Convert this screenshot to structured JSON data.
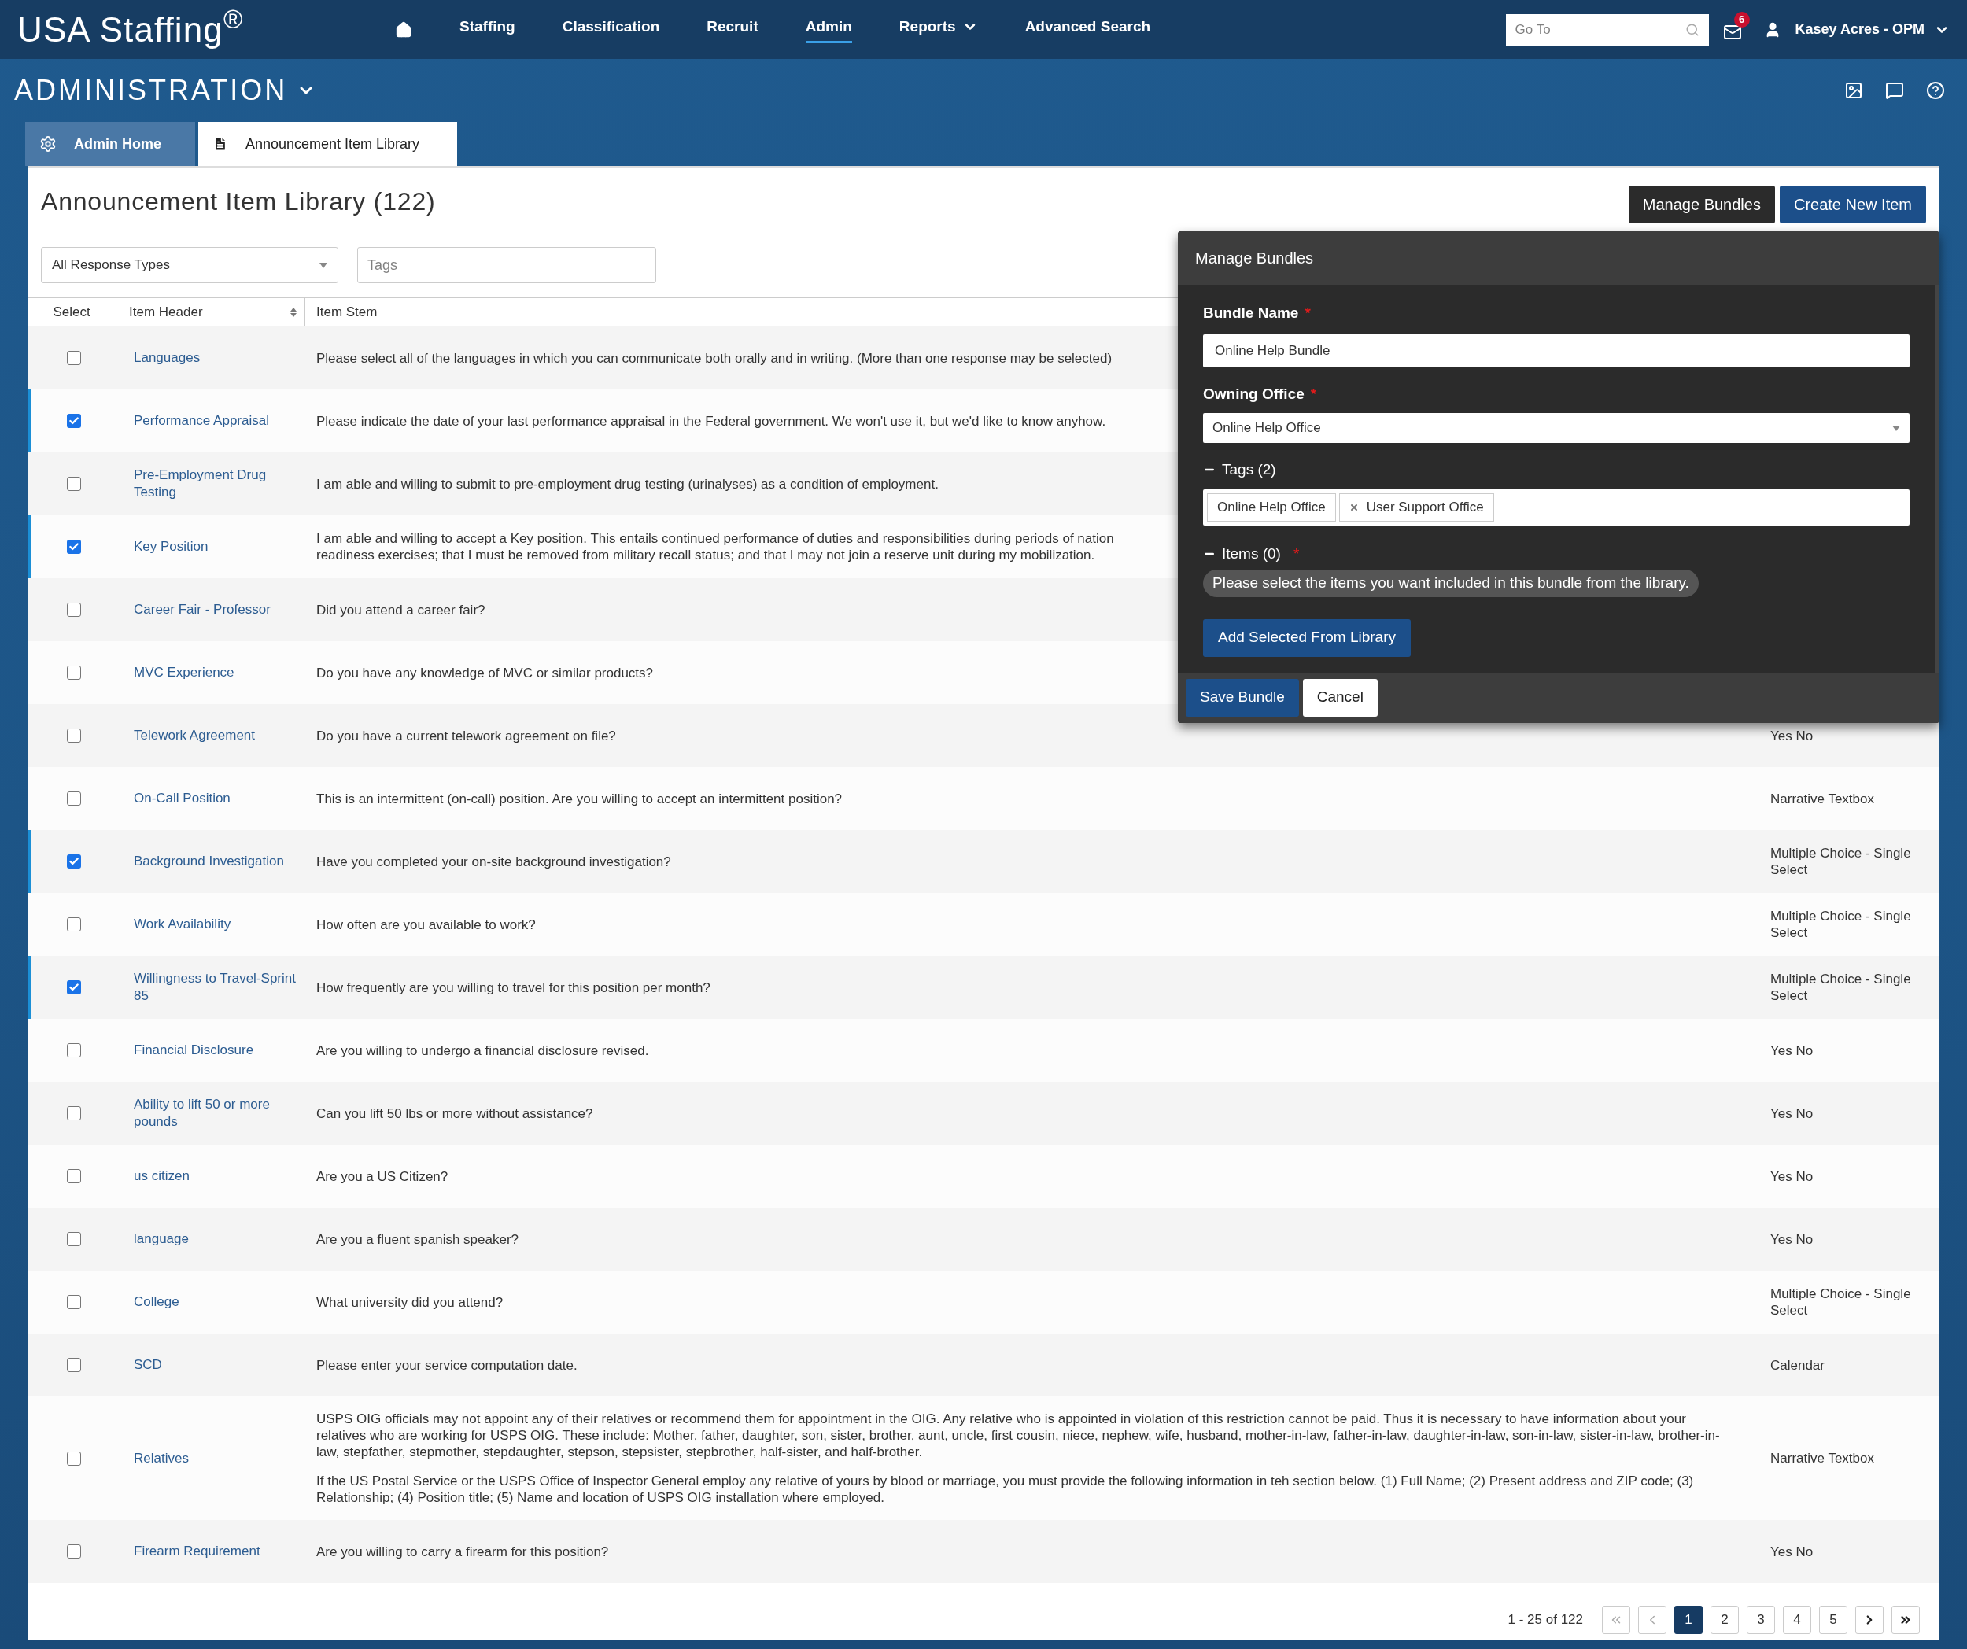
{
  "header": {
    "logo": "USA Staffing$^{®}$",
    "nav": [
      {
        "kind": "home",
        "selected": false
      },
      {
        "kind": "link",
        "label": "Staffing",
        "selected": false,
        "has_menu": false
      },
      {
        "kind": "link",
        "label": "Classification",
        "selected": false,
        "has_menu": false
      },
      {
        "kind": "link",
        "label": "Recruit",
        "selected": false,
        "has_menu": false
      },
      {
        "kind": "link",
        "label": "Admin",
        "selected": true,
        "has_menu": false
      },
      {
        "kind": "link",
        "label": "Reports",
        "selected": false,
        "has_menu": true
      },
      {
        "kind": "link",
        "label": "Advanced Search",
        "selected": false,
        "has_menu": false
      }
    ],
    "search": {
      "placeholder": "Go To"
    },
    "messages": {
      "count": "6"
    },
    "user": {
      "name": "Kasey Acres - OPM"
    }
  },
  "section": {
    "title": "ADMINISTRATION"
  },
  "tabs": [
    {
      "kind": "gear",
      "label": "Admin Home",
      "selected": false
    },
    {
      "kind": "document",
      "label": "Announcement Item Library",
      "selected": true
    }
  ],
  "page": {
    "title": "Announcement Item Library (122)",
    "buttons": [
      {
        "kind": "dark",
        "label": "Manage Bundles"
      },
      {
        "kind": "primary",
        "label": "Create New Item"
      }
    ],
    "filters": {
      "response_type": "All Response Types",
      "tags_placeholder": "Tags"
    }
  },
  "table": {
    "columns": [
      "Select",
      "Item Header",
      "Item Stem"
    ],
    "rows": [
      {
        "selected": false,
        "header": "Languages",
        "stem": [
          "Please select all of the languages in which you can communicate both orally and in writing. (More than one response may be selected)"
        ]
      },
      {
        "selected": true,
        "header": "Performance Appraisal",
        "stem": [
          "Please indicate the date of your last performance appraisal in the Federal government. We won't use it, but we'd like to know anyhow."
        ]
      },
      {
        "selected": false,
        "header": "Pre-Employment Drug Testing",
        "stem": [
          "I am able and willing to submit to pre-employment drug testing (urinalyses) as a condition of employment."
        ]
      },
      {
        "selected": true,
        "header": "Key Position",
        "stem": [
          [
            "I am able and willing to accept a Key position. This entails continued performance of duties and responsibilities during periods of nation",
            "readiness exercises; that I must be removed from military recall status; and that I may not join a reserve unit during my mobilization."
          ]
        ]
      },
      {
        "selected": false,
        "header": "Career Fair - Professor",
        "stem": [
          "Did you attend a career fair?"
        ]
      },
      {
        "selected": false,
        "header": "MVC Experience",
        "stem": [
          "Do you have any knowledge of MVC or similar products?"
        ]
      },
      {
        "selected": false,
        "header": "Telework Agreement",
        "stem": [
          "Do you have a current telework agreement on file?"
        ],
        "response": "Yes No"
      },
      {
        "selected": false,
        "header": "On-Call Position",
        "stem": [
          "This is an intermittent (on-call) position. Are you willing to accept an intermittent position?"
        ],
        "response": "Narrative Textbox"
      },
      {
        "selected": true,
        "header": "Background Investigation",
        "stem": [
          "Have you completed your on-site background investigation?"
        ],
        "response": "Multiple Choice - Single Select"
      },
      {
        "selected": false,
        "header": "Work Availability",
        "stem": [
          "How often are you available to work?"
        ],
        "response": "Multiple Choice - Single Select"
      },
      {
        "selected": true,
        "header": "Willingness to Travel-Sprint 85",
        "stem": [
          "How frequently are you willing to travel for this position per month?"
        ],
        "response": "Multiple Choice - Single Select"
      },
      {
        "selected": false,
        "header": "Financial Disclosure",
        "stem": [
          "Are you willing to undergo a financial disclosure revised."
        ],
        "response": "Yes No"
      },
      {
        "selected": false,
        "header": "Ability to lift 50 or more pounds",
        "stem": [
          "Can you lift 50 lbs or more without assistance?"
        ],
        "response": "Yes No"
      },
      {
        "selected": false,
        "header": "us citizen",
        "stem": [
          "Are you a US Citizen?"
        ],
        "response": "Yes No"
      },
      {
        "selected": false,
        "header": "language",
        "stem": [
          "Are you a fluent spanish speaker?"
        ],
        "response": "Yes No"
      },
      {
        "selected": false,
        "header": "College",
        "stem": [
          "What university did you attend?"
        ],
        "response": "Multiple Choice - Single Select"
      },
      {
        "selected": false,
        "header": "SCD",
        "stem": [
          "Please enter your service computation date."
        ],
        "response": "Calendar"
      },
      {
        "selected": false,
        "header": "Relatives",
        "stem": [
          "USPS OIG officials may not appoint any of their relatives or recommend them for appointment in the OIG. Any relative who is appointed in violation of this restriction cannot be paid. Thus it is necessary to have information about your relatives who are working for USPS OIG. These include: Mother, father, daughter, son, sister, brother, aunt, uncle, first cousin, niece, nephew, wife, husband, mother-in-law, father-in-law, daughter-in-law, son-in-law, sister-in-law, brother-in-law, stepfather, stepmother, stepdaughter, stepson, stepsister, stepbrother, half-sister, and half-brother.",
          "If the US Postal Service or the USPS Office of Inspector General employ any relative of yours by blood or marriage, you must provide the following information in teh section below. (1) Full Name; (2) Present address and ZIP code; (3) Relationship; (4) Position title; (5) Name and location of USPS OIG installation where employed."
        ],
        "response": "Narrative Textbox"
      },
      {
        "selected": false,
        "header": "Firearm Requirement",
        "stem": [
          "Are you willing to carry a firearm for this position?"
        ],
        "response": "Yes No"
      }
    ]
  },
  "pagination": {
    "summary": "1 - 25 of 122",
    "pages": [
      {
        "label": "1",
        "selected": true
      },
      {
        "label": "2",
        "selected": false
      },
      {
        "label": "3",
        "selected": false
      },
      {
        "label": "4",
        "selected": false
      },
      {
        "label": "5",
        "selected": false
      }
    ]
  },
  "modal": {
    "title": "Manage Bundles",
    "required_mark": "*",
    "bundle_name": {
      "label": "Bundle Name",
      "required": true,
      "value": "Online Help Bundle"
    },
    "owning_office": {
      "label": "Owning Office",
      "required": true,
      "value": "Online Help Office"
    },
    "tags": {
      "label": "Tags (2)",
      "expanded": true,
      "required": false,
      "items": [
        {
          "label": "Online Help Office",
          "removable": false
        },
        {
          "label": "User Support Office",
          "removable": true
        }
      ]
    },
    "items": {
      "label": "Items (0)",
      "expanded": true,
      "required": true,
      "message": "Please select the items you want included in this bundle from the library."
    },
    "add_button": "Add Selected From Library",
    "save_button": "Save Bundle",
    "cancel_button": "Cancel"
  }
}
